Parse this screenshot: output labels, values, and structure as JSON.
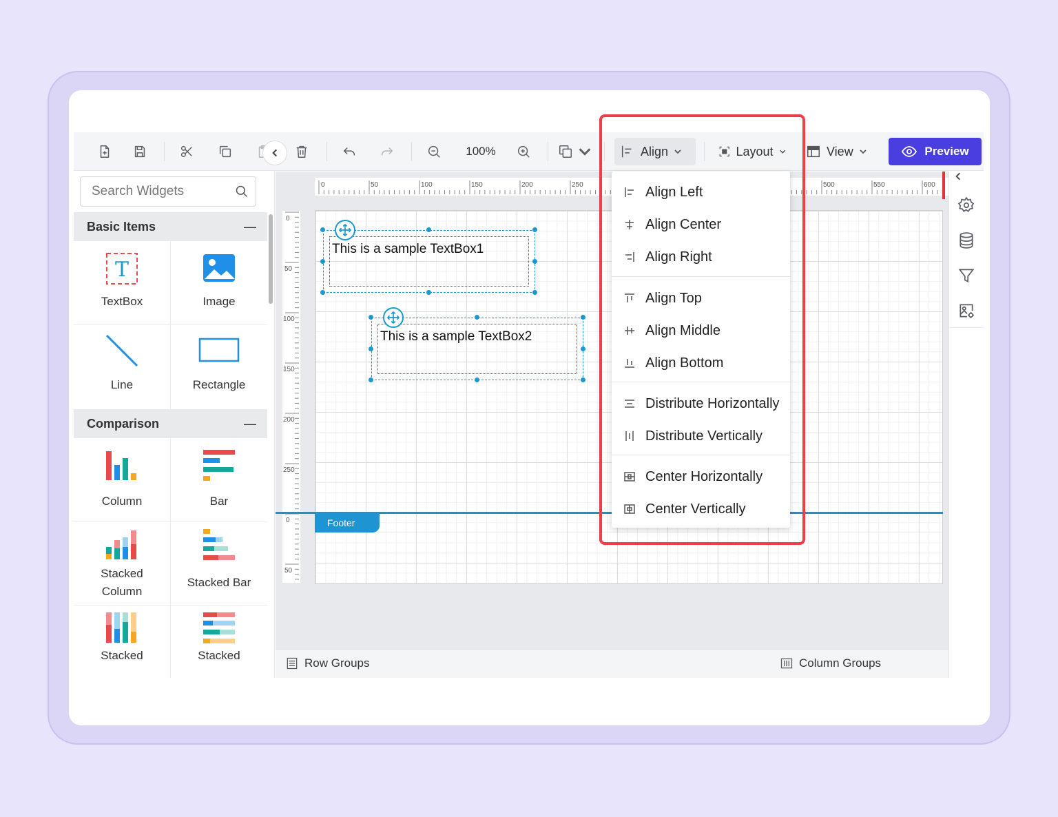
{
  "toolbar": {
    "zoom": "100%",
    "align_label": "Align",
    "layout_label": "Layout",
    "view_label": "View",
    "preview_label": "Preview"
  },
  "left_panel": {
    "search_placeholder": "Search Widgets",
    "sections": [
      {
        "title": "Basic Items",
        "items": [
          "TextBox",
          "Image",
          "Line",
          "Rectangle"
        ]
      },
      {
        "title": "Comparison",
        "items": [
          "Column",
          "Bar",
          "Stacked Column",
          "Stacked Bar",
          "Stacked",
          "Stacked"
        ]
      }
    ]
  },
  "rulers": {
    "top": [
      "0",
      "50",
      "100",
      "150",
      "200",
      "250",
      "500",
      "550",
      "600"
    ],
    "left": [
      "0",
      "50",
      "100",
      "150",
      "200",
      "250",
      "0",
      "50"
    ]
  },
  "canvas": {
    "textbox1": "This is a sample TextBox1",
    "textbox2": "This is a sample TextBox2",
    "footer": "Footer"
  },
  "bottombar": {
    "row_groups": "Row Groups",
    "column_groups": "Column Groups"
  },
  "align_menu": {
    "groups": [
      [
        "Align Left",
        "Align Center",
        "Align Right"
      ],
      [
        "Align Top",
        "Align Middle",
        "Align Bottom"
      ],
      [
        "Distribute Horizontally",
        "Distribute Vertically"
      ],
      [
        "Center Horizontally",
        "Center Vertically"
      ]
    ]
  },
  "colors": {
    "accent": "#4a3ee0",
    "selection": "#1a98d0",
    "highlight": "#ef3e4a",
    "background": "#e8e4fb"
  }
}
